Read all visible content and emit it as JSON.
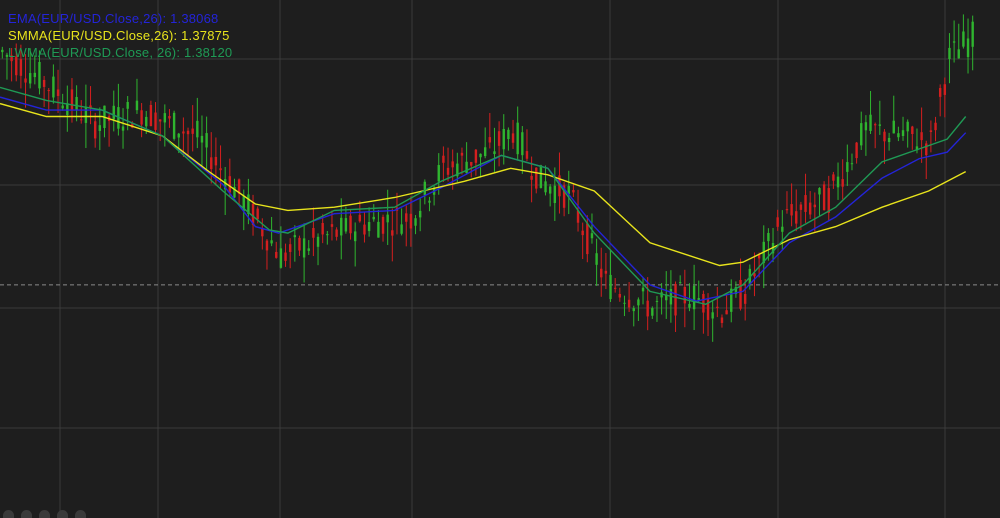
{
  "indicators": [
    {
      "label": "EMA(EUR/USD.Close,26): 1.38068",
      "color": "#2424d8"
    },
    {
      "label": "SMMA(EUR/USD.Close,26): 1.37875",
      "color": "#e8e41c"
    },
    {
      "label": "LWMA(EUR/USD.Close, 26): 1.38120",
      "color": "#1f9a55"
    }
  ],
  "colors": {
    "background": "#1e1e1e",
    "grid": "#3b3b3b",
    "bull": "#2fb52f",
    "bear": "#d41f1f",
    "current_price_line": "#8a8a8a"
  },
  "chart_data": {
    "type": "candlestick",
    "instrument": "EUR/USD",
    "grid": true,
    "current_price": 1.3772,
    "ylim": [
      1.37,
      1.386
    ],
    "candle_count": 210,
    "price_path": [
      [
        0,
        1.3844
      ],
      [
        8,
        1.3836
      ],
      [
        20,
        1.3822
      ],
      [
        30,
        1.3826
      ],
      [
        42,
        1.3818
      ],
      [
        52,
        1.3798
      ],
      [
        60,
        1.3781
      ],
      [
        68,
        1.3786
      ],
      [
        78,
        1.3791
      ],
      [
        88,
        1.3793
      ],
      [
        95,
        1.3808
      ],
      [
        105,
        1.3813
      ],
      [
        110,
        1.382
      ],
      [
        116,
        1.3804
      ],
      [
        122,
        1.38
      ],
      [
        130,
        1.3773
      ],
      [
        140,
        1.3765
      ],
      [
        148,
        1.3769
      ],
      [
        155,
        1.3764
      ],
      [
        160,
        1.377
      ],
      [
        168,
        1.3792
      ],
      [
        178,
        1.3799
      ],
      [
        186,
        1.382
      ],
      [
        195,
        1.3818
      ],
      [
        200,
        1.3816
      ],
      [
        204,
        1.3842
      ],
      [
        210,
        1.385
      ]
    ],
    "series": [
      {
        "name": "EMA(EUR/USD.Close,26)",
        "color": "#2424d8",
        "points": [
          [
            0,
            1.383
          ],
          [
            10,
            1.3826
          ],
          [
            22,
            1.3826
          ],
          [
            35,
            1.3818
          ],
          [
            48,
            1.3803
          ],
          [
            55,
            1.379
          ],
          [
            60,
            1.3788
          ],
          [
            72,
            1.3794
          ],
          [
            85,
            1.3795
          ],
          [
            95,
            1.3802
          ],
          [
            108,
            1.3812
          ],
          [
            118,
            1.3808
          ],
          [
            128,
            1.379
          ],
          [
            140,
            1.3772
          ],
          [
            150,
            1.3767
          ],
          [
            160,
            1.377
          ],
          [
            170,
            1.3785
          ],
          [
            180,
            1.3793
          ],
          [
            190,
            1.3805
          ],
          [
            198,
            1.3811
          ],
          [
            204,
            1.3813
          ],
          [
            208,
            1.3819
          ]
        ]
      },
      {
        "name": "SMMA(EUR/USD.Close,26)",
        "color": "#e8e41c",
        "points": [
          [
            0,
            1.3828
          ],
          [
            10,
            1.3824
          ],
          [
            22,
            1.3824
          ],
          [
            35,
            1.3818
          ],
          [
            45,
            1.3807
          ],
          [
            55,
            1.3797
          ],
          [
            62,
            1.3795
          ],
          [
            72,
            1.3796
          ],
          [
            85,
            1.3799
          ],
          [
            100,
            1.3804
          ],
          [
            110,
            1.3808
          ],
          [
            118,
            1.3806
          ],
          [
            128,
            1.3801
          ],
          [
            140,
            1.3785
          ],
          [
            155,
            1.3778
          ],
          [
            160,
            1.3779
          ],
          [
            170,
            1.3786
          ],
          [
            180,
            1.379
          ],
          [
            190,
            1.3796
          ],
          [
            200,
            1.3801
          ],
          [
            208,
            1.3807
          ]
        ]
      },
      {
        "name": "LWMA(EUR/USD.Close, 26)",
        "color": "#1f9a55",
        "points": [
          [
            0,
            1.3833
          ],
          [
            10,
            1.3829
          ],
          [
            22,
            1.3826
          ],
          [
            35,
            1.3818
          ],
          [
            48,
            1.3801
          ],
          [
            58,
            1.3789
          ],
          [
            62,
            1.3788
          ],
          [
            72,
            1.3795
          ],
          [
            85,
            1.3796
          ],
          [
            95,
            1.3804
          ],
          [
            108,
            1.3812
          ],
          [
            118,
            1.3808
          ],
          [
            128,
            1.3788
          ],
          [
            140,
            1.377
          ],
          [
            152,
            1.3766
          ],
          [
            160,
            1.3772
          ],
          [
            170,
            1.3788
          ],
          [
            180,
            1.3796
          ],
          [
            190,
            1.381
          ],
          [
            198,
            1.3814
          ],
          [
            204,
            1.3817
          ],
          [
            208,
            1.3824
          ]
        ]
      }
    ]
  }
}
